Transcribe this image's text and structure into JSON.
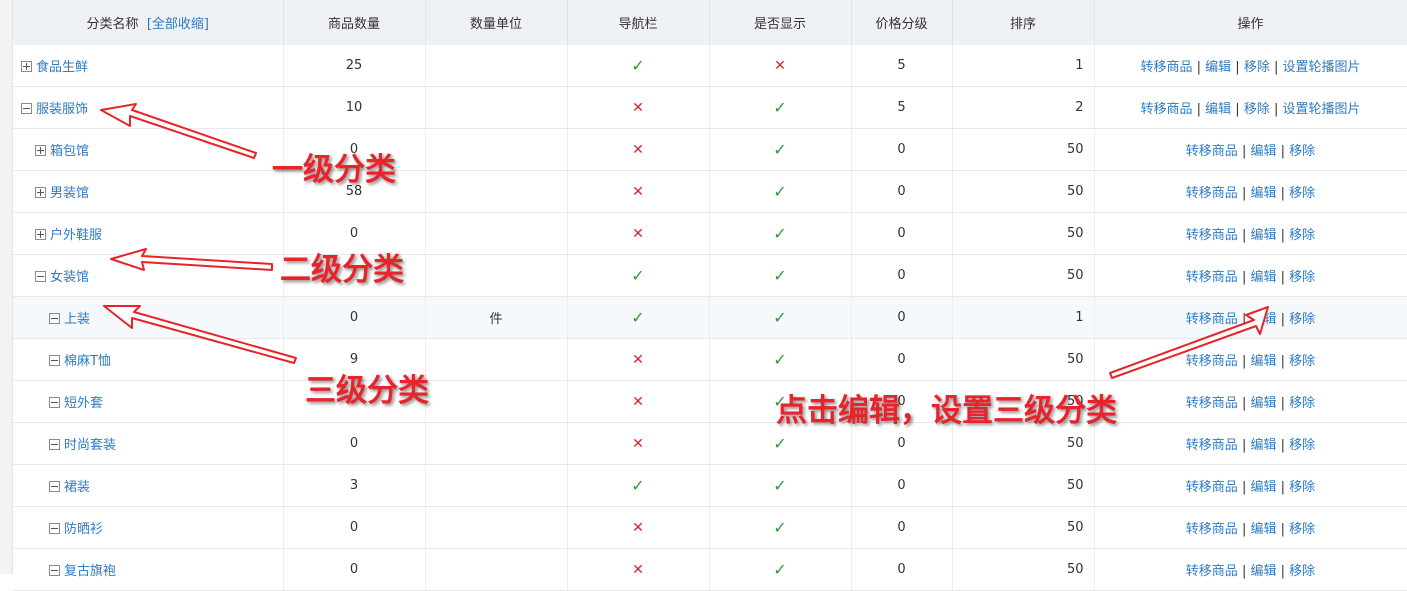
{
  "header": {
    "name": "分类名称",
    "collapse_all": "[全部收缩]",
    "count": "商品数量",
    "unit": "数量单位",
    "nav": "导航栏",
    "show": "是否显示",
    "price_level": "价格分级",
    "sort": "排序",
    "ops": "操作"
  },
  "ops": {
    "transfer": "转移商品",
    "edit": "编辑",
    "remove": "移除",
    "carousel": "设置轮播图片",
    "sep": "|"
  },
  "rows": [
    {
      "name": "食品生鲜",
      "level": 1,
      "toggle": "plus",
      "count": "25",
      "unit": "",
      "nav": "yes",
      "show": "no",
      "price_level": "5",
      "sort": "1",
      "carousel": true
    },
    {
      "name": "服装服饰",
      "level": 1,
      "toggle": "minus",
      "count": "10",
      "unit": "",
      "nav": "no",
      "show": "yes",
      "price_level": "5",
      "sort": "2",
      "carousel": true
    },
    {
      "name": "箱包馆",
      "level": 2,
      "toggle": "plus",
      "count": "0",
      "unit": "",
      "nav": "no",
      "show": "yes",
      "price_level": "0",
      "sort": "50",
      "carousel": false
    },
    {
      "name": "男装馆",
      "level": 2,
      "toggle": "plus",
      "count": "58",
      "unit": "",
      "nav": "no",
      "show": "yes",
      "price_level": "0",
      "sort": "50",
      "carousel": false
    },
    {
      "name": "户外鞋服",
      "level": 2,
      "toggle": "plus",
      "count": "0",
      "unit": "",
      "nav": "no",
      "show": "yes",
      "price_level": "0",
      "sort": "50",
      "carousel": false
    },
    {
      "name": "女装馆",
      "level": 2,
      "toggle": "minus",
      "count": "",
      "unit": "",
      "nav": "yes",
      "show": "yes",
      "price_level": "0",
      "sort": "50",
      "carousel": false
    },
    {
      "name": "上装",
      "level": 3,
      "toggle": "minus",
      "count": "0",
      "unit": "件",
      "nav": "yes",
      "show": "yes",
      "price_level": "0",
      "sort": "1",
      "carousel": false,
      "highlight": true
    },
    {
      "name": "棉麻T恤",
      "level": 3,
      "toggle": "minus",
      "count": "9",
      "unit": "",
      "nav": "no",
      "show": "yes",
      "price_level": "0",
      "sort": "50",
      "carousel": false
    },
    {
      "name": "短外套",
      "level": 3,
      "toggle": "minus",
      "count": "",
      "unit": "",
      "nav": "no",
      "show": "yes",
      "price_level": "0",
      "sort": "50",
      "carousel": false
    },
    {
      "name": "时尚套装",
      "level": 3,
      "toggle": "minus",
      "count": "0",
      "unit": "",
      "nav": "no",
      "show": "yes",
      "price_level": "0",
      "sort": "50",
      "carousel": false
    },
    {
      "name": "裙装",
      "level": 3,
      "toggle": "minus",
      "count": "3",
      "unit": "",
      "nav": "yes",
      "show": "yes",
      "price_level": "0",
      "sort": "50",
      "carousel": false
    },
    {
      "name": "防晒衫",
      "level": 3,
      "toggle": "minus",
      "count": "0",
      "unit": "",
      "nav": "no",
      "show": "yes",
      "price_level": "0",
      "sort": "50",
      "carousel": false
    },
    {
      "name": "复古旗袍",
      "level": 3,
      "toggle": "minus",
      "count": "0",
      "unit": "",
      "nav": "no",
      "show": "yes",
      "price_level": "0",
      "sort": "50",
      "carousel": false
    }
  ],
  "annotations": {
    "level1": "一级分类",
    "level2": "二级分类",
    "level3": "三级分类",
    "edit_hint": "点击编辑，设置三级分类"
  },
  "colors": {
    "link": "#2f7bc4",
    "check": "#2c9a3d",
    "cross": "#d9262b",
    "annotation": "#e8242a",
    "header_bg": "#eef1f5"
  }
}
